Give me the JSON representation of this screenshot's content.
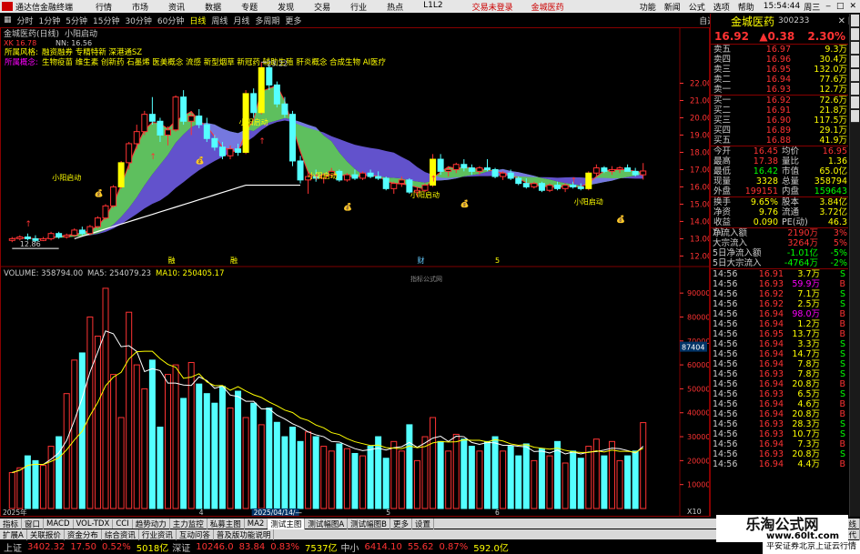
{
  "titlebar": {
    "app": "通达信金融终端",
    "menus": [
      "行情",
      "市场",
      "资讯",
      "数据",
      "专题",
      "发现",
      "交易",
      "行业",
      "热点",
      "L1L2"
    ],
    "promo1": "交易未登录",
    "promo2": "金城医药",
    "right": [
      "功能",
      "新闻",
      "公式",
      "选项",
      "帮助"
    ],
    "time": "15:54:44",
    "weekday": "周三"
  },
  "periodbar": {
    "periods": [
      "分时",
      "1分钟",
      "5分钟",
      "15分钟",
      "30分钟",
      "60分钟",
      "日线",
      "周线",
      "月线",
      "多周期",
      "更多"
    ],
    "active": "日线",
    "right": [
      "自选",
      "个股",
      "综合",
      "F10",
      "标记",
      "还原",
      "返回"
    ]
  },
  "chart": {
    "title": "金城医药(日线)",
    "indicator": "小阳启动",
    "nn_label": "NN: 16.56",
    "xk_label": "XK 16.78",
    "style_label": "所属风格:",
    "style_text": "融资融券 专精特新 深港通SZ",
    "concept_label": "所属概念:",
    "concept_text": "生物疫苗 维生素 创新药 石墨烯 医美概念 流感 新型烟草 新冠药 辅助生殖 肝炎概念 合成生物 AI医疗",
    "high_mark": "23.22",
    "low_mark": "12.86",
    "marker_text": "小阳启动",
    "y_ticks": [
      "22.00",
      "21.00",
      "20.00",
      "19.00",
      "18.00",
      "17.00",
      "16.00",
      "15.00",
      "14.00",
      "13.00",
      "12.00"
    ],
    "vol_label": "VOLUME: 358794.00",
    "ma5_label": "MA5: 254079.23",
    "ma10_label": "MA10: 250405.17",
    "vol_ticks": [
      "90000",
      "80000",
      "70000",
      "60000",
      "50000",
      "40000",
      "30000",
      "20000",
      "10000"
    ],
    "vol_unit": "X10",
    "formula_watermark": "指标公式网",
    "vol_marker": "87404",
    "x_labels": [
      "2025年",
      "4",
      "2025/04/14/—",
      "5",
      "6"
    ],
    "event_labels": [
      "融",
      "融",
      "财",
      "5"
    ]
  },
  "quote": {
    "name": "金城医药",
    "code": "300233",
    "price": "16.92",
    "change": "▲0.38",
    "pct": "2.30%",
    "asks": [
      {
        "l": "卖五",
        "p": "16.97",
        "v": "9.3万"
      },
      {
        "l": "卖四",
        "p": "16.96",
        "v": "30.4万"
      },
      {
        "l": "卖三",
        "p": "16.95",
        "v": "132.0万"
      },
      {
        "l": "卖二",
        "p": "16.94",
        "v": "77.6万"
      },
      {
        "l": "卖一",
        "p": "16.93",
        "v": "12.7万"
      }
    ],
    "bids": [
      {
        "l": "买一",
        "p": "16.92",
        "v": "72.6万"
      },
      {
        "l": "买二",
        "p": "16.91",
        "v": "21.8万"
      },
      {
        "l": "买三",
        "p": "16.90",
        "v": "117.5万"
      },
      {
        "l": "买四",
        "p": "16.89",
        "v": "29.1万"
      },
      {
        "l": "买五",
        "p": "16.88",
        "v": "41.9万"
      }
    ],
    "stats": [
      {
        "a": "今开",
        "b": "16.45",
        "c": "均价",
        "d": "16.95"
      },
      {
        "a": "最高",
        "b": "17.38",
        "c": "量比",
        "d": "1.36"
      },
      {
        "a": "最低",
        "b": "16.42",
        "c": "市值",
        "d": "65.0亿"
      },
      {
        "a": "现量",
        "b": "3328",
        "c": "总量",
        "d": "358794"
      },
      {
        "a": "外盘",
        "b": "199151",
        "c": "内盘",
        "d": "159643"
      }
    ],
    "stats2": [
      {
        "a": "换手",
        "b": "9.65%",
        "c": "股本",
        "d": "3.84亿"
      },
      {
        "a": "净资",
        "b": "9.76",
        "c": "流通",
        "d": "3.72亿"
      },
      {
        "a": "收益(-)",
        "b": "0.090",
        "c": "PE(动)",
        "d": "46.3"
      }
    ],
    "flows": [
      {
        "a": "净流入额",
        "b": "2190万",
        "c": "3%"
      },
      {
        "a": "大宗流入",
        "b": "3264万",
        "c": "5%"
      },
      {
        "a": "5日净流入额",
        "b": "-1.01亿",
        "c": "-5%"
      },
      {
        "a": "5日大宗流入",
        "b": "-4764万",
        "c": "-2%"
      }
    ],
    "ticks": [
      {
        "t": "14:56",
        "p": "16.91",
        "v": "3.7万",
        "s": "S"
      },
      {
        "t": "14:56",
        "p": "16.93",
        "v": "59.9万",
        "s": "B"
      },
      {
        "t": "14:56",
        "p": "16.92",
        "v": "7.1万",
        "s": "S"
      },
      {
        "t": "14:56",
        "p": "16.92",
        "v": "2.5万",
        "s": "S"
      },
      {
        "t": "14:56",
        "p": "16.94",
        "v": "98.0万",
        "s": "B"
      },
      {
        "t": "14:56",
        "p": "16.94",
        "v": "1.2万",
        "s": "B"
      },
      {
        "t": "14:56",
        "p": "16.95",
        "v": "13.7万",
        "s": "B"
      },
      {
        "t": "14:56",
        "p": "16.94",
        "v": "3.3万",
        "s": "S"
      },
      {
        "t": "14:56",
        "p": "16.94",
        "v": "14.7万",
        "s": "S"
      },
      {
        "t": "14:56",
        "p": "16.94",
        "v": "7.8万",
        "s": "S"
      },
      {
        "t": "14:56",
        "p": "16.93",
        "v": "7.8万",
        "s": "S"
      },
      {
        "t": "14:56",
        "p": "16.94",
        "v": "20.8万",
        "s": "B"
      },
      {
        "t": "14:56",
        "p": "16.93",
        "v": "6.5万",
        "s": "S"
      },
      {
        "t": "14:56",
        "p": "16.94",
        "v": "4.6万",
        "s": "B"
      },
      {
        "t": "14:56",
        "p": "16.94",
        "v": "20.8万",
        "s": "B"
      },
      {
        "t": "14:56",
        "p": "16.93",
        "v": "28.3万",
        "s": "S"
      },
      {
        "t": "14:56",
        "p": "16.93",
        "v": "10.7万",
        "s": "S"
      },
      {
        "t": "14:56",
        "p": "16.94",
        "v": "7.3万",
        "s": "B"
      },
      {
        "t": "14:56",
        "p": "16.93",
        "v": "20.8万",
        "s": "S"
      },
      {
        "t": "14:56",
        "p": "16.94",
        "v": "4.4万",
        "s": "B"
      }
    ]
  },
  "indtabs": {
    "items": [
      "指标",
      "窗口",
      "MACD",
      "VOL-TDX",
      "CCI",
      "趋势动力",
      "主力监控",
      "私募主图",
      "MA2",
      "测试主图",
      "测试幅图A",
      "测试幅图B",
      "更多",
      "设置"
    ],
    "active": "测试主图",
    "right": [
      "模板",
      "日线"
    ]
  },
  "subtabs": {
    "items": [
      "扩展A",
      "关联报价",
      "资金分布",
      "综合资讯",
      "行业资讯",
      "互动问答",
      "普及版功能说明"
    ],
    "right": [
      "图文F10",
      "韵达代"
    ]
  },
  "indexbar": [
    {
      "k": "上证",
      "v": "3402.32",
      "c": "17.50",
      "p": "0.52%",
      "a": "5018亿"
    },
    {
      "k": "深证",
      "v": "10246.0",
      "c": "83.84",
      "p": "0.83%",
      "a": "7537亿"
    },
    {
      "k": "中小",
      "v": "6414.10",
      "c": "55.62",
      "p": "0.87%",
      "a": "592.0亿"
    }
  ],
  "broker": "平安证券北京上证云行情",
  "watermark": {
    "t1": "乐淘公式网",
    "t2": "www.60lt.com"
  },
  "colors": {
    "up": "#ff3333",
    "down": "#54ffff",
    "yellow": "#ffff00",
    "frame": "#800000"
  },
  "chart_data": {
    "type": "candlestick",
    "price_ylim": [
      11.6,
      23.5
    ],
    "volume_ylim": [
      0,
      95000
    ],
    "candles": [
      [
        12.9,
        13.1,
        12.8,
        13.0
      ],
      [
        13.0,
        13.2,
        12.9,
        13.1
      ],
      [
        13.1,
        13.3,
        12.9,
        13.0
      ],
      [
        13.0,
        13.2,
        12.8,
        12.9
      ],
      [
        12.9,
        13.1,
        12.86,
        13.0
      ],
      [
        13.0,
        13.4,
        12.9,
        13.3
      ],
      [
        13.3,
        13.4,
        13.0,
        13.1
      ],
      [
        13.1,
        13.3,
        13.0,
        13.2
      ],
      [
        13.2,
        13.6,
        13.1,
        13.5
      ],
      [
        13.5,
        13.7,
        13.2,
        13.3
      ],
      [
        13.3,
        13.8,
        13.2,
        13.7
      ],
      [
        13.7,
        14.3,
        13.6,
        14.2
      ],
      [
        14.2,
        15.0,
        14.1,
        14.9
      ],
      [
        14.9,
        16.1,
        14.8,
        16.0
      ],
      [
        16.0,
        17.5,
        15.9,
        17.4
      ],
      [
        17.4,
        18.6,
        17.0,
        18.5
      ],
      [
        18.5,
        19.6,
        18.2,
        19.2
      ],
      [
        19.2,
        20.4,
        19.0,
        20.2
      ],
      [
        20.2,
        21.2,
        19.6,
        19.8
      ],
      [
        19.8,
        20.0,
        18.6,
        19.0
      ],
      [
        19.0,
        19.5,
        18.4,
        19.3
      ],
      [
        19.3,
        21.3,
        19.2,
        21.2
      ],
      [
        21.2,
        21.6,
        19.6,
        19.8
      ],
      [
        19.8,
        20.3,
        19.0,
        20.1
      ],
      [
        20.1,
        20.5,
        19.4,
        19.6
      ],
      [
        19.6,
        20.0,
        18.6,
        18.8
      ],
      [
        18.8,
        19.0,
        18.1,
        18.3
      ],
      [
        18.3,
        18.6,
        17.6,
        17.8
      ],
      [
        17.8,
        18.4,
        17.6,
        18.2
      ],
      [
        18.2,
        18.5,
        17.8,
        18.0
      ],
      [
        18.0,
        21.6,
        17.9,
        21.4
      ],
      [
        21.4,
        21.7,
        20.0,
        20.3
      ],
      [
        20.3,
        23.22,
        20.2,
        22.9
      ],
      [
        22.9,
        23.0,
        21.6,
        21.9
      ],
      [
        21.9,
        22.1,
        20.6,
        20.8
      ],
      [
        20.8,
        21.2,
        20.0,
        20.2
      ],
      [
        20.2,
        20.4,
        17.2,
        17.5
      ],
      [
        17.5,
        17.8,
        16.2,
        16.4
      ],
      [
        16.4,
        16.9,
        15.6,
        16.6
      ],
      [
        16.6,
        17.0,
        16.3,
        16.5
      ],
      [
        16.5,
        16.8,
        16.2,
        16.7
      ],
      [
        16.7,
        17.1,
        16.5,
        16.9
      ],
      [
        16.9,
        17.0,
        16.3,
        16.4
      ],
      [
        16.4,
        16.8,
        16.3,
        16.7
      ],
      [
        16.7,
        17.0,
        16.4,
        16.5
      ],
      [
        16.5,
        16.9,
        16.4,
        16.8
      ],
      [
        16.8,
        17.0,
        16.5,
        16.6
      ],
      [
        16.6,
        16.9,
        16.4,
        16.5
      ],
      [
        16.5,
        16.6,
        15.8,
        15.9
      ],
      [
        15.9,
        16.3,
        15.6,
        16.2
      ],
      [
        16.2,
        16.6,
        16.0,
        16.4
      ],
      [
        16.4,
        16.5,
        15.6,
        15.7
      ],
      [
        15.7,
        16.0,
        15.4,
        15.8
      ],
      [
        15.8,
        16.2,
        15.7,
        16.1
      ],
      [
        16.1,
        17.9,
        16.0,
        17.6
      ],
      [
        17.6,
        17.9,
        16.7,
        16.9
      ],
      [
        16.9,
        17.2,
        16.6,
        17.0
      ],
      [
        17.0,
        17.4,
        16.8,
        17.3
      ],
      [
        17.3,
        17.6,
        16.9,
        17.1
      ],
      [
        17.1,
        17.3,
        16.7,
        16.9
      ],
      [
        16.9,
        17.2,
        16.7,
        17.1
      ],
      [
        17.1,
        17.6,
        16.9,
        17.0
      ],
      [
        17.0,
        17.1,
        16.5,
        16.6
      ],
      [
        16.6,
        16.9,
        16.4,
        16.8
      ],
      [
        16.8,
        17.0,
        16.4,
        16.5
      ],
      [
        16.5,
        16.6,
        16.1,
        16.2
      ],
      [
        16.2,
        16.5,
        15.9,
        16.0
      ],
      [
        16.0,
        16.3,
        15.9,
        16.2
      ],
      [
        16.2,
        16.3,
        15.7,
        15.8
      ],
      [
        15.8,
        16.2,
        15.7,
        16.1
      ],
      [
        16.1,
        16.3,
        15.8,
        15.9
      ],
      [
        15.9,
        16.2,
        15.7,
        16.1
      ],
      [
        16.1,
        16.3,
        15.9,
        16.0
      ],
      [
        16.0,
        16.2,
        15.8,
        15.9
      ],
      [
        15.9,
        16.9,
        15.8,
        16.8
      ],
      [
        16.8,
        17.3,
        16.6,
        17.1
      ],
      [
        17.1,
        17.2,
        16.8,
        16.9
      ],
      [
        16.9,
        17.2,
        16.7,
        17.0
      ],
      [
        17.0,
        17.2,
        16.8,
        17.1
      ],
      [
        17.1,
        17.3,
        16.9,
        16.9
      ],
      [
        16.9,
        17.1,
        16.6,
        16.7
      ],
      [
        16.7,
        17.38,
        16.42,
        16.92
      ]
    ],
    "volumes": [
      15000,
      17000,
      22000,
      20000,
      18000,
      26000,
      30000,
      48000,
      62000,
      65000,
      80000,
      72000,
      92000,
      56000,
      38000,
      82000,
      60000,
      50000,
      62000,
      34000,
      56000,
      60000,
      46000,
      61000,
      52000,
      48000,
      44000,
      51000,
      42000,
      49000,
      38000,
      44000,
      35000,
      42000,
      36000,
      30000,
      34000,
      28000,
      32000,
      30000,
      26000,
      24000,
      27000,
      25000,
      23000,
      22000,
      26000,
      30000,
      21000,
      28000,
      24000,
      35000,
      20000,
      30000,
      38000,
      28000,
      24000,
      31000,
      29000,
      26000,
      24000,
      28000,
      30000,
      24000,
      26000,
      22000,
      27000,
      20000,
      25000,
      22000,
      28000,
      19000,
      24000,
      21000,
      26000,
      29000,
      22000,
      28000,
      20000,
      22000,
      24000,
      35879
    ]
  }
}
